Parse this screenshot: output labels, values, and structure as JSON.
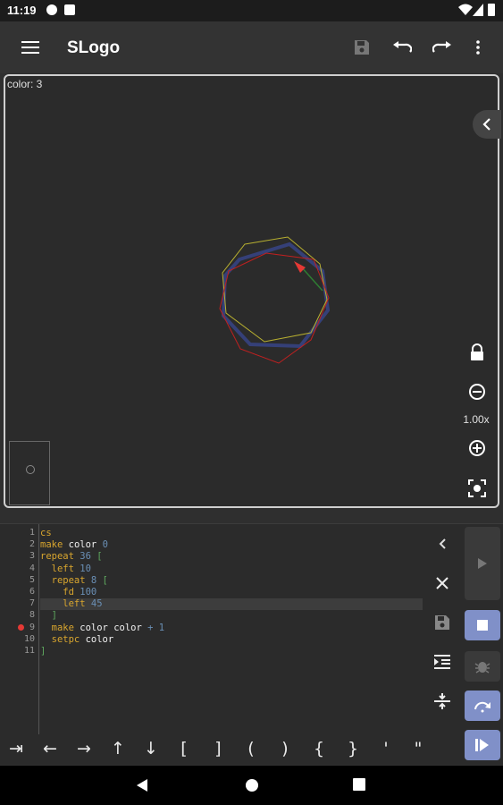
{
  "status_bar": {
    "time": "11:19"
  },
  "app_bar": {
    "title": "SLogo"
  },
  "canvas": {
    "color_readout": "color: 3",
    "zoom_level": "1.00x"
  },
  "editor": {
    "line_numbers": [
      "1",
      "2",
      "3",
      "4",
      "5",
      "6",
      "7",
      "8",
      "9",
      "10",
      "11"
    ],
    "active_line": 7,
    "breakpoint_line": 9,
    "lines": [
      [
        {
          "t": "cs",
          "c": "kw"
        }
      ],
      [
        {
          "t": "make",
          "c": "kw"
        },
        {
          "t": " color ",
          "c": "var"
        },
        {
          "t": "0",
          "c": "num"
        }
      ],
      [
        {
          "t": "repeat",
          "c": "kw"
        },
        {
          "t": " 36 ",
          "c": "num"
        },
        {
          "t": "[",
          "c": "brk"
        }
      ],
      [
        {
          "t": "  left",
          "c": "kw"
        },
        {
          "t": " 10",
          "c": "num"
        }
      ],
      [
        {
          "t": "  repeat",
          "c": "kw"
        },
        {
          "t": " 8 ",
          "c": "num"
        },
        {
          "t": "[",
          "c": "brk"
        }
      ],
      [
        {
          "t": "    fd",
          "c": "kw"
        },
        {
          "t": " 100",
          "c": "num"
        }
      ],
      [
        {
          "t": "    left",
          "c": "kw"
        },
        {
          "t": " 45",
          "c": "num"
        }
      ],
      [
        {
          "t": "  ]",
          "c": "brk"
        }
      ],
      [
        {
          "t": "  make",
          "c": "kw"
        },
        {
          "t": " color color ",
          "c": "var"
        },
        {
          "t": "+ 1",
          "c": "op"
        }
      ],
      [
        {
          "t": "  setpc",
          "c": "kw"
        },
        {
          "t": " color",
          "c": "var"
        }
      ],
      [
        {
          "t": "]",
          "c": "brk"
        }
      ]
    ]
  },
  "symbols": [
    "⇥",
    "←",
    "→",
    "↑",
    "↓",
    "[",
    "]",
    "(",
    ")",
    "{",
    "}",
    "'",
    "\""
  ],
  "icons": {
    "menu": "menu-icon",
    "save": "save-icon",
    "undo": "undo-icon",
    "redo": "redo-icon",
    "more": "more-vert-icon",
    "lock": "lock-icon",
    "zoom_out": "zoom-out-icon",
    "zoom_in": "zoom-in-icon",
    "fit": "fit-screen-icon",
    "play": "play-icon",
    "stop": "stop-icon",
    "debug": "bug-icon",
    "step_over": "step-over-icon",
    "step_into": "step-into-icon"
  },
  "colors": {
    "accent_button": "#8090c8",
    "breakpoint": "#e53935"
  }
}
